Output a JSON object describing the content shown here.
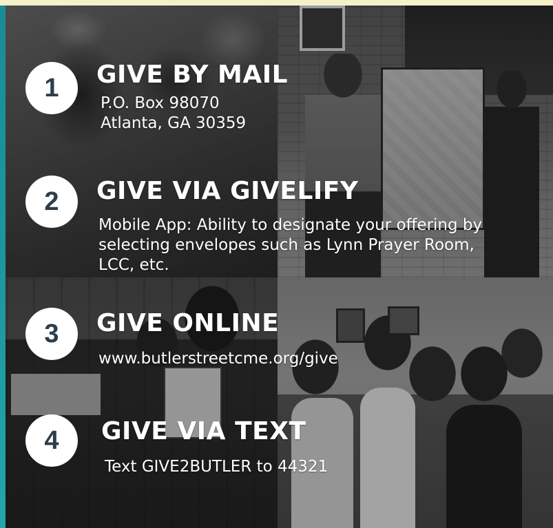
{
  "steps": [
    {
      "number": "1",
      "title": "GIVE BY MAIL",
      "lines": [
        "P.O. Box 98070",
        "Atlanta, GA 30359"
      ]
    },
    {
      "number": "2",
      "title": "GIVE VIA GIVELIFY",
      "lines": [
        "Mobile App: Ability to designate your offering by",
        "selecting envelopes such as Lynn Prayer Room,",
        "LCC, etc."
      ]
    },
    {
      "number": "3",
      "title": "GIVE ONLINE",
      "lines": [
        "www.butlerstreetcme.org/give"
      ]
    },
    {
      "number": "4",
      "title": "GIVE VIA TEXT",
      "lines": [
        "Text GIVE2BUTLER to 44321"
      ]
    }
  ],
  "colors": {
    "top_strip": "#f6f0c8",
    "left_accent": "#1c9a9f",
    "number_text": "#2c3e4c",
    "circle_fill": "#ffffff",
    "text": "#ffffff"
  }
}
